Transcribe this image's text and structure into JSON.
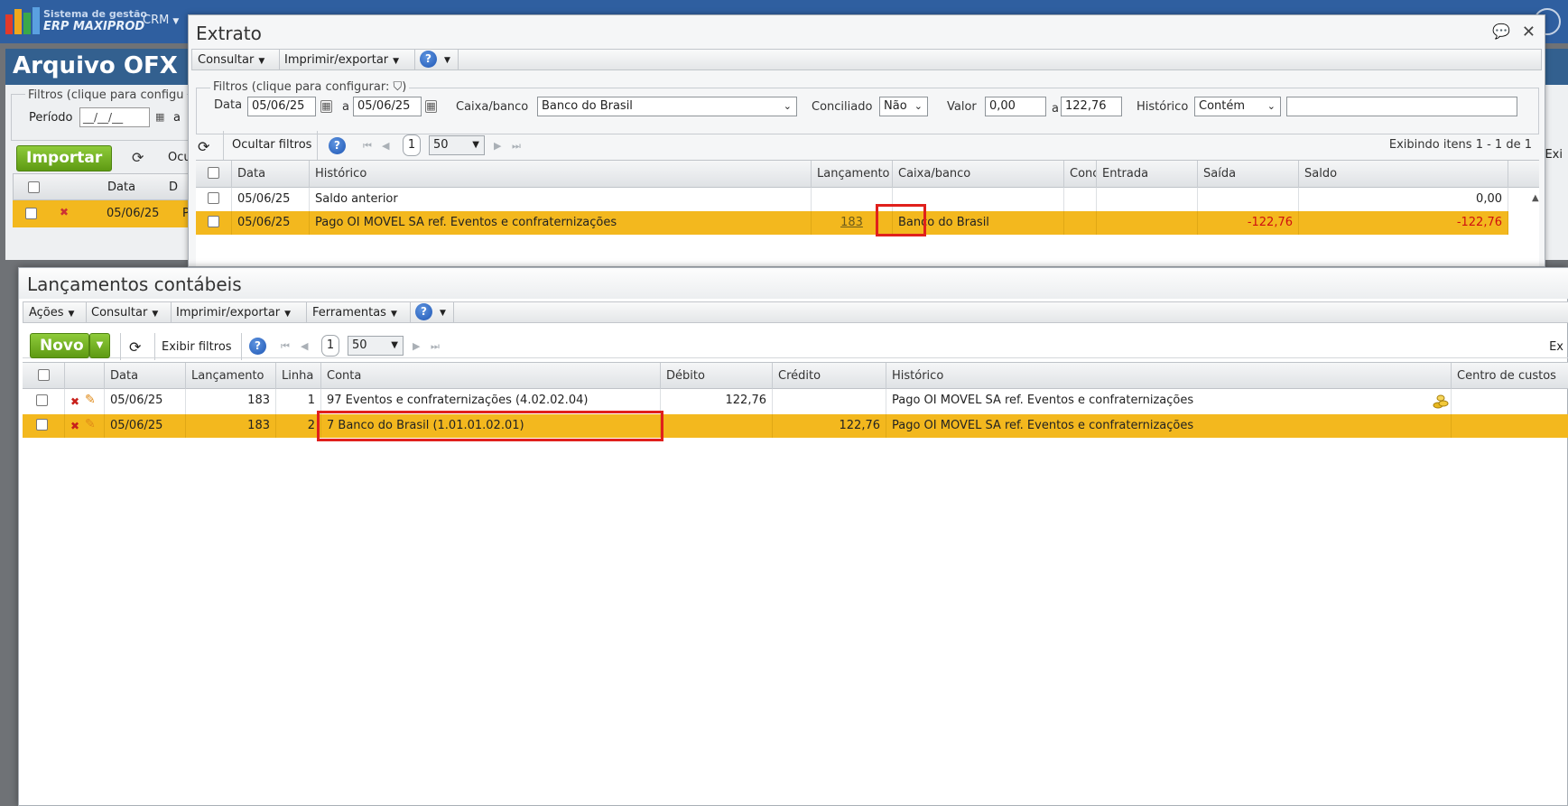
{
  "app": {
    "brand_line1": "Sistema de gestão",
    "brand_line2": "ERP MAXIPROD",
    "menu_crm": "CRM"
  },
  "background_page": {
    "title": "Arquivo OFX",
    "filters_label": "Filtros (clique para configu",
    "periodo_label": "Período",
    "periodo_value": "__/__/__",
    "a_label": "a",
    "import_button": "Importar",
    "ocultar_short": "Ocu",
    "exibindo_short": "Exi",
    "columns": [
      "Data",
      "D"
    ],
    "row": {
      "data": "05/06/25",
      "d": "P"
    }
  },
  "extrato": {
    "title": "Extrato",
    "menu": {
      "consultar": "Consultar",
      "imprimir": "Imprimir/exportar"
    },
    "filters_legend": "Filtros (clique para configurar:",
    "filters_legend_close": ")",
    "filters": {
      "data_label": "Data",
      "data_from": "05/06/25",
      "a_label": "a",
      "data_to": "05/06/25",
      "caixa_label": "Caixa/banco",
      "caixa_value": "Banco do Brasil",
      "conciliado_label": "Conciliado",
      "conciliado_value": "Não",
      "valor_label": "Valor",
      "valor_from": "0,00",
      "valor_a": "a",
      "valor_to": "122,76",
      "historico_label": "Histórico",
      "historico_op": "Contém",
      "historico_value": ""
    },
    "toolbar": {
      "ocultar_filtros": "Ocultar filtros",
      "page": "1",
      "page_size": "50",
      "exibindo": "Exibindo itens 1 - 1 de 1"
    },
    "columns": {
      "data": "Data",
      "historico": "Histórico",
      "lancamento": "Lançamento",
      "caixa": "Caixa/banco",
      "conc": "Conc",
      "entrada": "Entrada",
      "saida": "Saída",
      "saldo": "Saldo"
    },
    "rows": [
      {
        "data": "05/06/25",
        "historico": "Saldo anterior",
        "lancamento": "",
        "caixa": "",
        "entrada": "",
        "saida": "",
        "saldo": "0,00"
      },
      {
        "data": "05/06/25",
        "historico": "Pago OI MOVEL SA ref. Eventos e confraternizações",
        "lancamento": "183",
        "caixa": "Banco do Brasil",
        "entrada": "",
        "saida": "-122,76",
        "saldo": "-122,76"
      }
    ]
  },
  "lancamentos": {
    "title": "Lançamentos contábeis",
    "menu": {
      "acoes": "Ações",
      "consultar": "Consultar",
      "imprimir": "Imprimir/exportar",
      "ferramentas": "Ferramentas"
    },
    "toolbar": {
      "novo": "Novo",
      "exibir_filtros": "Exibir filtros",
      "page": "1",
      "page_size": "50",
      "exibindo_short": "Ex"
    },
    "columns": {
      "data": "Data",
      "lancamento": "Lançamento",
      "linha": "Linha",
      "conta": "Conta",
      "debito": "Débito",
      "credito": "Crédito",
      "historico": "Histórico",
      "centro": "Centro de custos"
    },
    "rows": [
      {
        "data": "05/06/25",
        "lancamento": "183",
        "linha": "1",
        "conta": "97 Eventos e confraternizações (4.02.02.04)",
        "debito": "122,76",
        "credito": "",
        "historico": "Pago OI MOVEL SA ref. Eventos e confraternizações",
        "centro": ""
      },
      {
        "data": "05/06/25",
        "lancamento": "183",
        "linha": "2",
        "conta": "7 Banco do Brasil (1.01.01.02.01)",
        "debito": "",
        "credito": "122,76",
        "historico": "Pago OI MOVEL SA ref. Eventos e confraternizações",
        "centro": ""
      }
    ]
  },
  "colors": {
    "highlight": "#f3b81e",
    "accent_red": "#e0201c",
    "brand_blue": "#2f5fa0",
    "green": "#6aaa1a"
  },
  "icons": [
    "refresh-icon",
    "help-icon",
    "filter-icon",
    "calendar-icon",
    "delete-icon",
    "edit-icon",
    "coins-icon",
    "close-icon",
    "chat-icon"
  ]
}
